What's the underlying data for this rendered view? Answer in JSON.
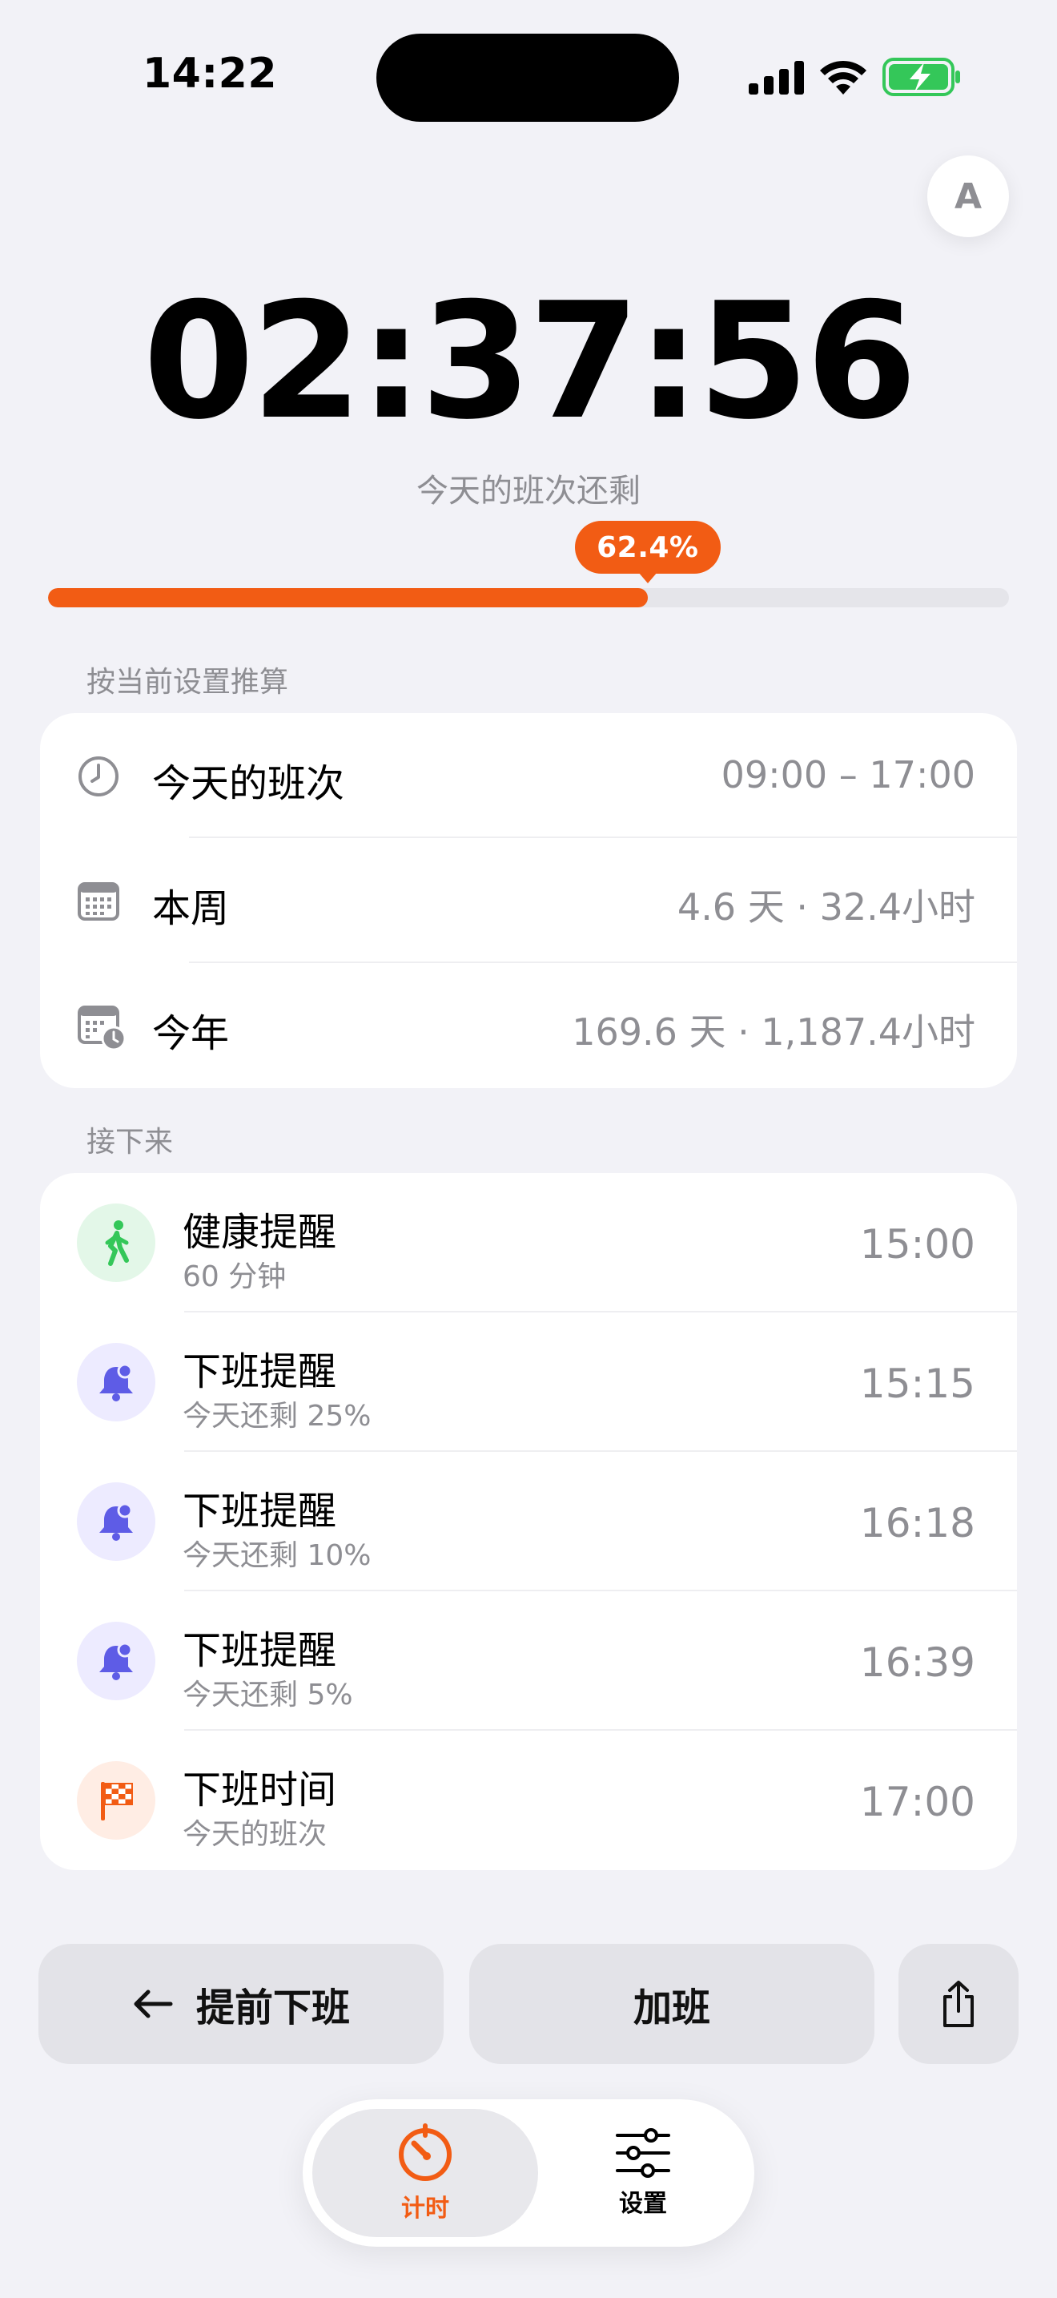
{
  "status": {
    "time": "14:22"
  },
  "avatar_letter": "A",
  "timer": {
    "countdown": "02:37:56",
    "subtitle": "今天的班次还剩",
    "progress_percent": 62.4,
    "progress_label": "62.4%"
  },
  "estimate_section": {
    "label": "按当前设置推算",
    "rows": [
      {
        "icon": "clock-icon",
        "title": "今天的班次",
        "value": "09:00 – 17:00"
      },
      {
        "icon": "calendar-icon",
        "title": "本周",
        "value": "4.6 天 · 32.4小时"
      },
      {
        "icon": "calendar-clock-icon",
        "title": "今年",
        "value": "169.6 天 · 1,187.4小时"
      }
    ]
  },
  "upcoming_section": {
    "label": "接下来",
    "items": [
      {
        "icon": "walking-icon",
        "title": "健康提醒",
        "subtitle": "60 分钟",
        "time": "15:00"
      },
      {
        "icon": "bell-badge-icon",
        "title": "下班提醒",
        "subtitle": "今天还剩 25%",
        "time": "15:15"
      },
      {
        "icon": "bell-badge-icon",
        "title": "下班提醒",
        "subtitle": "今天还剩 10%",
        "time": "16:18"
      },
      {
        "icon": "bell-badge-icon",
        "title": "下班提醒",
        "subtitle": "今天还剩 5%",
        "time": "16:39"
      },
      {
        "icon": "checkered-flag-icon",
        "title": "下班时间",
        "subtitle": "今天的班次",
        "time": "17:00"
      }
    ]
  },
  "actions": {
    "early_leave_label": "提前下班",
    "overtime_label": "加班"
  },
  "tabs": {
    "timer_label": "计时",
    "settings_label": "设置"
  },
  "colors": {
    "accent": "#F25C14",
    "background": "#F2F2F7",
    "health_tint": "#E3F7E8",
    "health_icon": "#34C759",
    "reminder_tint": "#EDEBFF",
    "reminder_icon": "#5E5CE6",
    "flag_tint": "#FFEDE4"
  }
}
